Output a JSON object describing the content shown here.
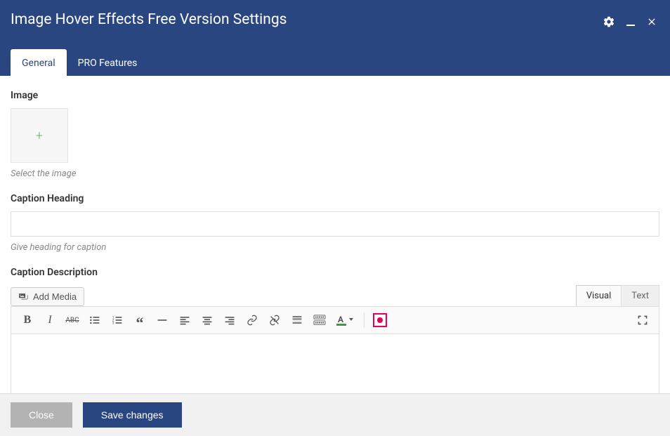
{
  "header": {
    "title": "Image Hover Effects Free Version Settings",
    "tabs": [
      {
        "label": "General",
        "active": true
      },
      {
        "label": "PRO Features",
        "active": false
      }
    ]
  },
  "fields": {
    "image": {
      "label": "Image",
      "hint": "Select the image"
    },
    "caption_heading": {
      "label": "Caption Heading",
      "value": "",
      "hint": "Give heading for caption"
    },
    "caption_description": {
      "label": "Caption Description",
      "add_media": "Add Media",
      "editor_tabs": {
        "visual": "Visual",
        "text": "Text"
      }
    }
  },
  "footer": {
    "close": "Close",
    "save": "Save changes"
  }
}
